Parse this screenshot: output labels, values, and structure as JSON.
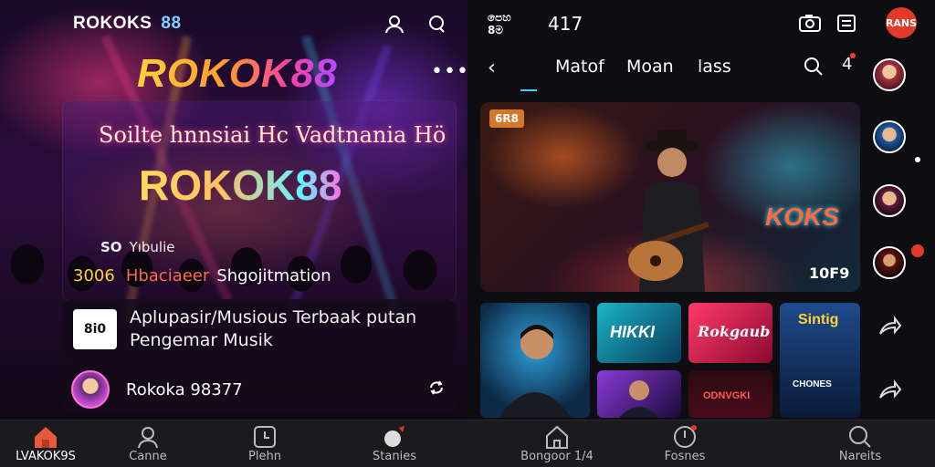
{
  "left": {
    "brand": "ROKOKS",
    "brand_num": "88",
    "logo": "ROKOK88",
    "tagline": "Soilte hnnsiai Hc Vadtnania Hö",
    "logo_mid": "ROKOK88",
    "stat1_num": "SO",
    "stat1_label": "Yıbulie",
    "stat2_num": "3006",
    "stat2_a": "Hbaciaeer",
    "stat2_b": "Shgojitmation",
    "message_badge": "8i0",
    "message_line1": "Aplupasir/Musious Terbaak putan",
    "message_line2": "Pengemar Musik",
    "user_name": "Rokoka 98377"
  },
  "right": {
    "top_a": "පෙහ\n8ම",
    "top_b": "417",
    "badge_text": "RANS",
    "tabs": [
      "Matof",
      "Moan",
      "lass"
    ],
    "notif_count": "4",
    "hero_tag": "6R8",
    "hero_kicker": "KOKS",
    "hero_count": "10F9",
    "thumbs": {
      "t2": "HIKKI",
      "t3": "Rokgaub",
      "t4": "Sintig",
      "t4_sub": "CHONES",
      "t6": "ODNVGKI"
    }
  },
  "bottom_nav": [
    {
      "label": "LVAKOK9S",
      "icon": "home-icon",
      "active": true
    },
    {
      "label": "Canne",
      "icon": "person-icon",
      "active": false
    },
    {
      "label": "Plehn",
      "icon": "clock-icon",
      "active": false
    },
    {
      "label": "Stanies",
      "icon": "music-note-icon",
      "active": false
    },
    {
      "label": "Bongoor 1/4",
      "icon": "home-outline-icon",
      "active": false
    },
    {
      "label": "Fosnes",
      "icon": "timer-icon",
      "active": false
    },
    {
      "label": "Nareits",
      "icon": "search-icon",
      "active": false
    }
  ],
  "colors": {
    "accent_gold": "#ffd23a",
    "accent_pink": "#ff3fa2",
    "accent_blue": "#3ad0ff",
    "badge_red": "#e23a2a"
  }
}
